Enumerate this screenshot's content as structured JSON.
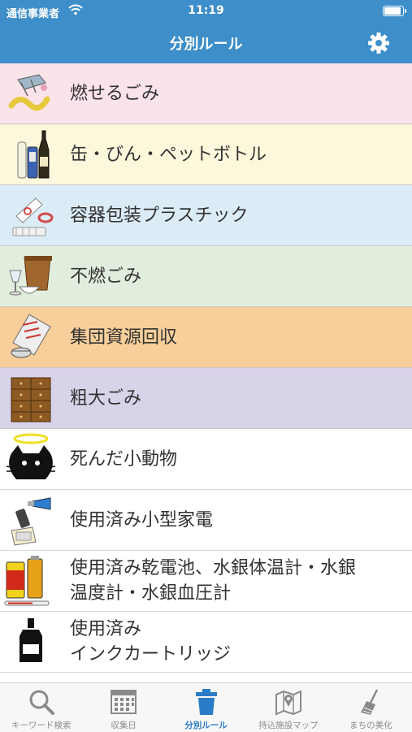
{
  "status_bar": {
    "carrier": "通信事業者",
    "time": "11:19"
  },
  "nav": {
    "title": "分別ルール",
    "settings_icon": "gear-icon"
  },
  "colors": {
    "header": "#3d8ec9",
    "active_tab": "#2a7cc7"
  },
  "categories": [
    {
      "label": "燃せるごみ",
      "bg": "#fbe3ea",
      "icon": "burnable-trash-icon"
    },
    {
      "label": "缶・びん・ペットボトル",
      "bg": "#fdf8dc",
      "icon": "bottles-cans-icon"
    },
    {
      "label": "容器包装プラスチック",
      "bg": "#dcecf7",
      "icon": "plastic-packaging-icon"
    },
    {
      "label": "不燃ごみ",
      "bg": "#e2eedd",
      "icon": "nonburnable-trash-icon"
    },
    {
      "label": "集団資源回収",
      "bg": "#f8cf9a",
      "icon": "resource-recycling-icon"
    },
    {
      "label": "粗大ごみ",
      "bg": "#d9d3ea",
      "icon": "oversized-trash-icon"
    },
    {
      "label": "死んだ小動物",
      "bg": "#ffffff",
      "icon": "dead-animal-icon"
    },
    {
      "label": "使用済み小型家電",
      "bg": "#ffffff",
      "icon": "small-appliance-icon"
    },
    {
      "label_lines": [
        "使用済み乾電池、水銀体温計・水銀",
        "温度計・水銀血圧計"
      ],
      "bg": "#ffffff",
      "icon": "battery-thermometer-icon"
    },
    {
      "label_lines": [
        "使用済み",
        "インクカートリッジ"
      ],
      "bg": "#ffffff",
      "icon": "ink-cartridge-icon"
    }
  ],
  "tabs": [
    {
      "label": "キーワード検索",
      "icon": "search-icon",
      "active": false
    },
    {
      "label": "収集日",
      "icon": "calendar-icon",
      "active": false
    },
    {
      "label": "分別ルール",
      "icon": "trash-can-icon",
      "active": true
    },
    {
      "label": "持込施設マップ",
      "icon": "map-icon",
      "active": false
    },
    {
      "label": "まちの美化",
      "icon": "broom-icon",
      "active": false
    }
  ]
}
